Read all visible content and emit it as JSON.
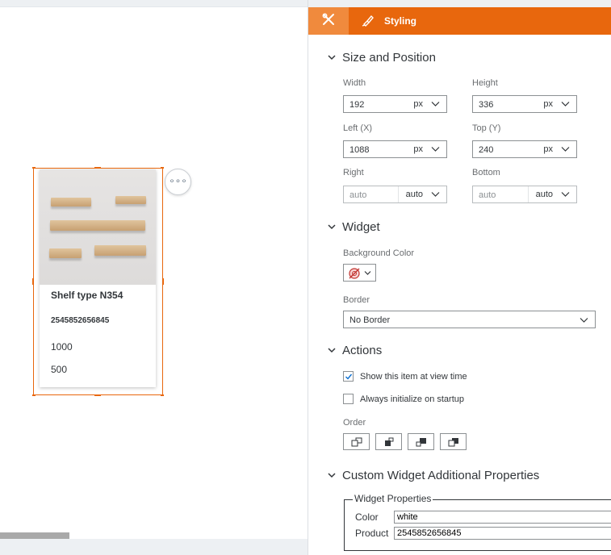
{
  "canvas": {
    "card": {
      "title": "Shelf type N354",
      "code": "2545852656845",
      "value1": "1000",
      "value2": "500"
    },
    "more_button_label": "∘∘∘",
    "selection_color": "#e8670d"
  },
  "panel": {
    "tabs": {
      "builder_icon": "wrench-screwdriver-icon",
      "styling_icon": "paint-brush-icon",
      "styling_label": "Styling"
    },
    "accent_color": "#e8670d",
    "size_position": {
      "title": "Size and Position",
      "width": {
        "label": "Width",
        "value": "192",
        "unit": "px"
      },
      "height": {
        "label": "Height",
        "value": "336",
        "unit": "px"
      },
      "left": {
        "label": "Left (X)",
        "value": "1088",
        "unit": "px"
      },
      "top": {
        "label": "Top (Y)",
        "value": "240",
        "unit": "px"
      },
      "right": {
        "label": "Right",
        "value": "auto",
        "unit": "auto"
      },
      "bottom": {
        "label": "Bottom",
        "value": "auto",
        "unit": "auto"
      }
    },
    "widget": {
      "title": "Widget",
      "bg_color_label": "Background Color",
      "border_label": "Border",
      "border_value": "No Border"
    },
    "actions": {
      "title": "Actions",
      "show_item_label": "Show this item at view time",
      "show_item_checked": true,
      "always_init_label": "Always initialize on startup",
      "always_init_checked": false,
      "order_label": "Order",
      "order_icons": [
        "bring-to-front-icon",
        "bring-forward-icon",
        "send-backward-icon",
        "send-to-back-icon"
      ]
    },
    "custom": {
      "title": "Custom Widget Additional Properties",
      "legend": "Widget Properties",
      "color_label": "Color",
      "color_value": "white",
      "product_label": "Product",
      "product_value": "2545852656845"
    }
  }
}
